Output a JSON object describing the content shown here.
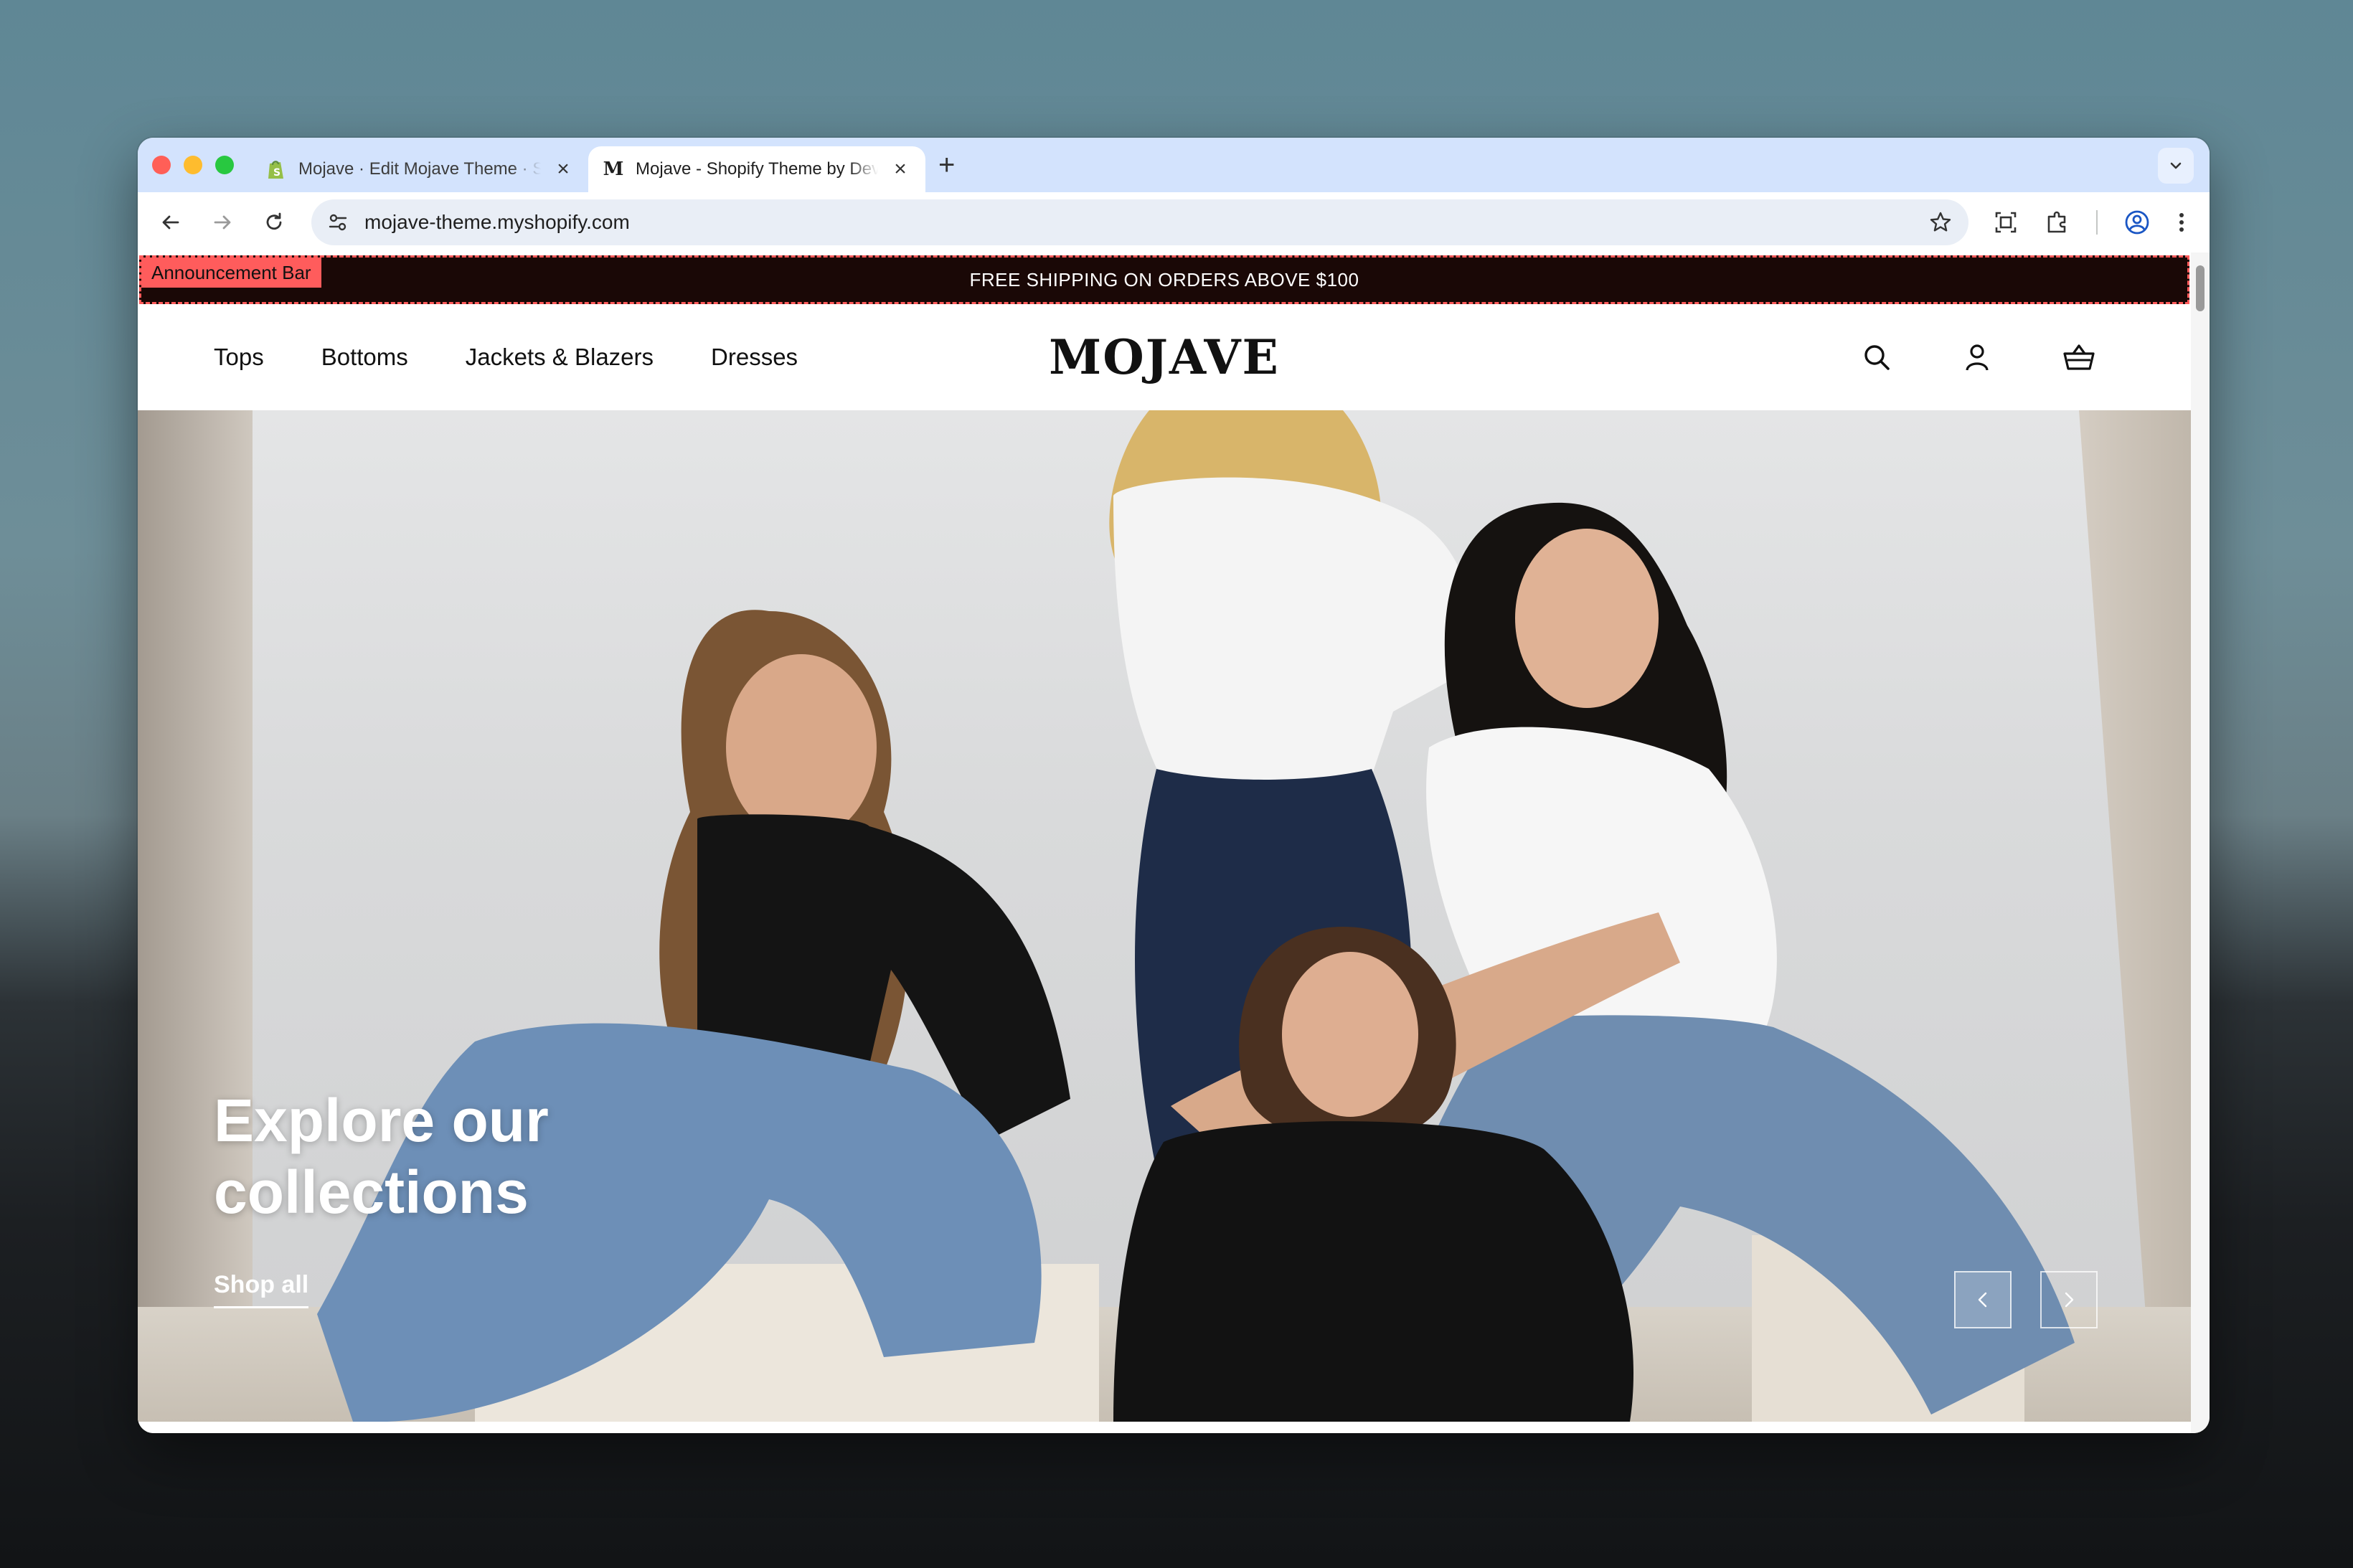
{
  "browser": {
    "tabs": [
      {
        "title": "Mojave · Edit Mojave Theme · Shopify",
        "favicon": "shopify-icon",
        "active": false
      },
      {
        "title": "Mojave - Shopify Theme by Dev",
        "favicon": "mojave-m-icon",
        "favicon_glyph": "M",
        "active": true
      }
    ],
    "new_tab": "+",
    "url": "mojave-theme.myshopify.com"
  },
  "store": {
    "announcement": {
      "text": "FREE SHIPPING ON ORDERS ABOVE $100",
      "editor_label": "Announcement Bar"
    },
    "nav": [
      {
        "label": "Tops"
      },
      {
        "label": "Bottoms"
      },
      {
        "label": "Jackets & Blazers"
      },
      {
        "label": "Dresses"
      }
    ],
    "logo": "MOJAVE",
    "hero": {
      "heading_line1": "Explore our",
      "heading_line2": "collections",
      "cta": "Shop all"
    }
  },
  "colors": {
    "announcement_bg": "#1a0806",
    "editor_highlight": "#ff5c5c",
    "tabstrip_bg": "#d3e3fd"
  }
}
